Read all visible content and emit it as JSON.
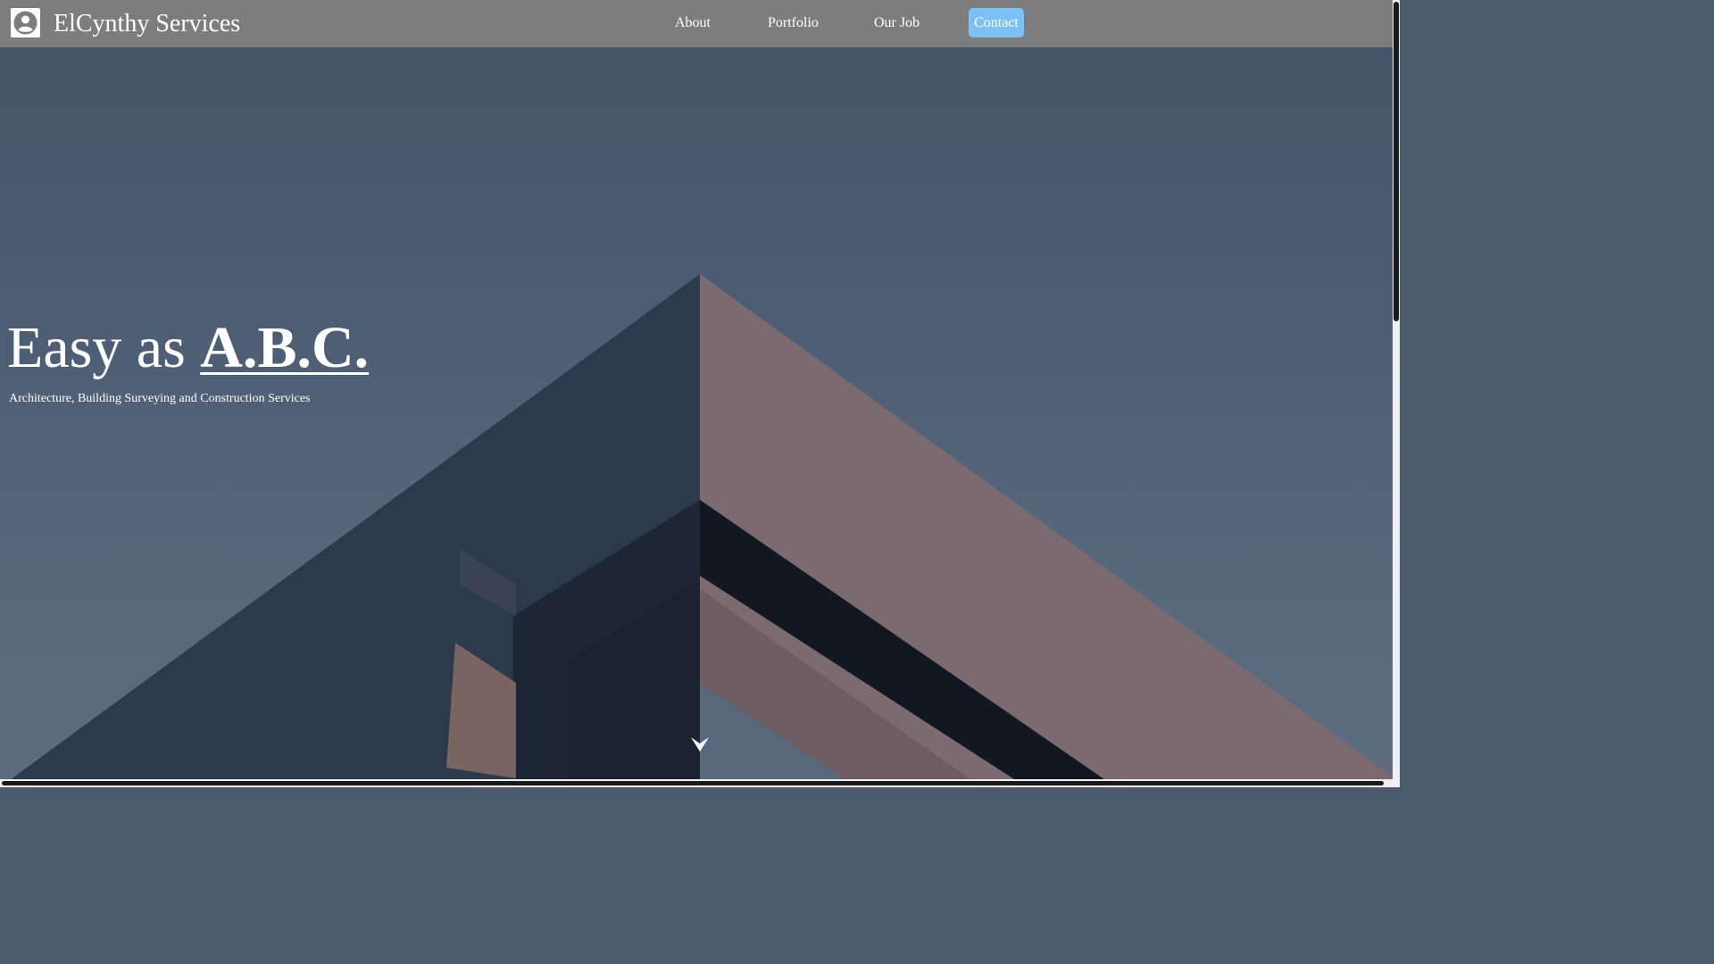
{
  "header": {
    "brand": "ElCynthy Services",
    "logo_icon": "user-circle-icon",
    "nav": {
      "about": "About",
      "portfolio": "Portfolio",
      "our_job": "Our Job",
      "contact": "Contact"
    }
  },
  "hero": {
    "headline_prefix": "Easy as",
    "headline_accent": "A.B.C.",
    "tagline": "Architecture, Building Surveying and Construction Services",
    "scroll_icon": "chevron-down-icon"
  },
  "colors": {
    "header_bg": "#7d7d7d",
    "contact_button": "#7cc1f5",
    "text": "#ffffff"
  }
}
